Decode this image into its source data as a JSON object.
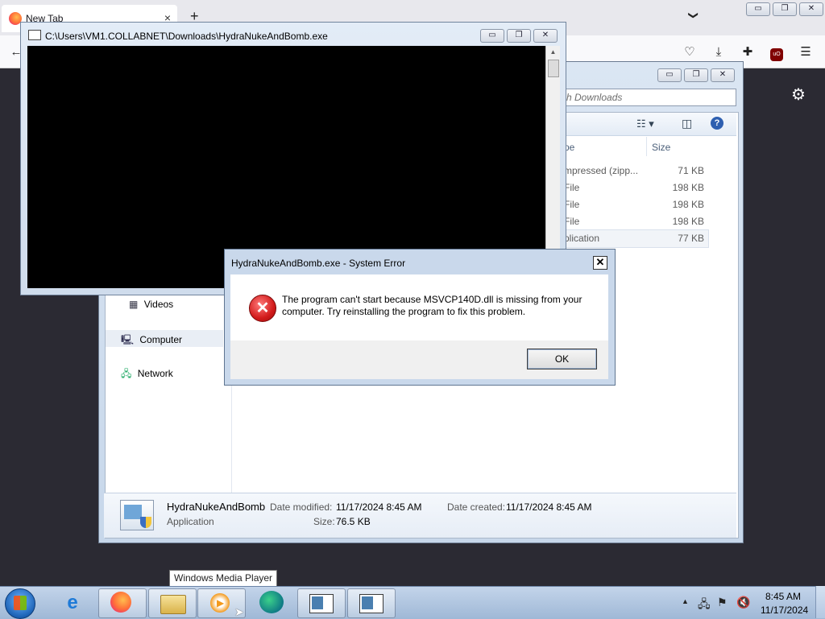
{
  "firefox": {
    "tab_title": "New Tab",
    "tab_close": "×",
    "new_tab": "+",
    "tabs_menu": "❯",
    "window_controls": {
      "minimize": "▭",
      "restore": "❐",
      "close": "✕"
    },
    "toolbar_icons": [
      "back-icon",
      "pocket-icon",
      "download-icon",
      "extensions-icon",
      "ublock-icon",
      "menu-icon"
    ],
    "settings_icon": "gear-icon"
  },
  "explorer": {
    "search_placeholder": "rch Downloads",
    "columns": {
      "type": "pe",
      "size": "Size"
    },
    "rows": [
      {
        "type": "mpressed (zipp...",
        "size": "71 KB"
      },
      {
        "type": "File",
        "size": "198 KB"
      },
      {
        "type": "File",
        "size": "198 KB"
      },
      {
        "type": "File",
        "size": "198 KB"
      },
      {
        "type": "plication",
        "size": "77 KB"
      }
    ],
    "nav": {
      "videos": "Videos",
      "computer": "Computer",
      "network": "Network"
    },
    "details": {
      "name": "HydraNukeAndBomb",
      "kind": "Application",
      "date_modified_label": "Date modified:",
      "date_modified": "11/17/2024 8:45 AM",
      "date_created_label": "Date created:",
      "date_created": "11/17/2024 8:45 AM",
      "size_label": "Size:",
      "size": "76.5 KB"
    }
  },
  "console": {
    "title": "C:\\Users\\VM1.COLLABNET\\Downloads\\HydraNukeAndBomb.exe"
  },
  "dialog": {
    "title": "HydraNukeAndBomb.exe - System Error",
    "close": "✕",
    "message": "The program can't start because MSVCP140D.dll is missing from your computer. Try reinstalling the program to fix this problem.",
    "ok": "OK"
  },
  "tooltip": "Windows Media Player",
  "taskbar": {
    "apps": [
      "internet-explorer-icon",
      "firefox-icon",
      "file-explorer-icon",
      "windows-media-player-icon",
      "edge-icon",
      "console-window-icon",
      "console-window-icon"
    ],
    "time": "8:45 AM",
    "date": "11/17/2024"
  }
}
